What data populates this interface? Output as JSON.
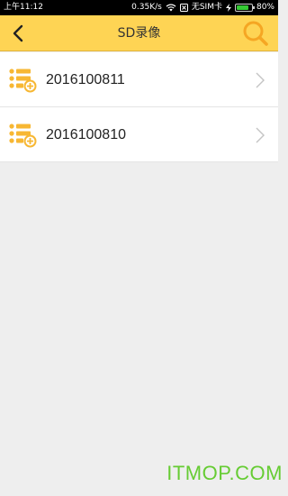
{
  "status_bar": {
    "time": "上午11:12",
    "network_speed": "0.35K/s",
    "sim_status": "无SIM卡",
    "battery": "80%",
    "battery_level": 0.8
  },
  "header": {
    "title": "SD录像",
    "accent_color": "#fed454",
    "search_icon_color": "#f5a623"
  },
  "records": [
    {
      "label": "2016100811"
    },
    {
      "label": "2016100810"
    }
  ],
  "watermark": "ITMOP.COM"
}
